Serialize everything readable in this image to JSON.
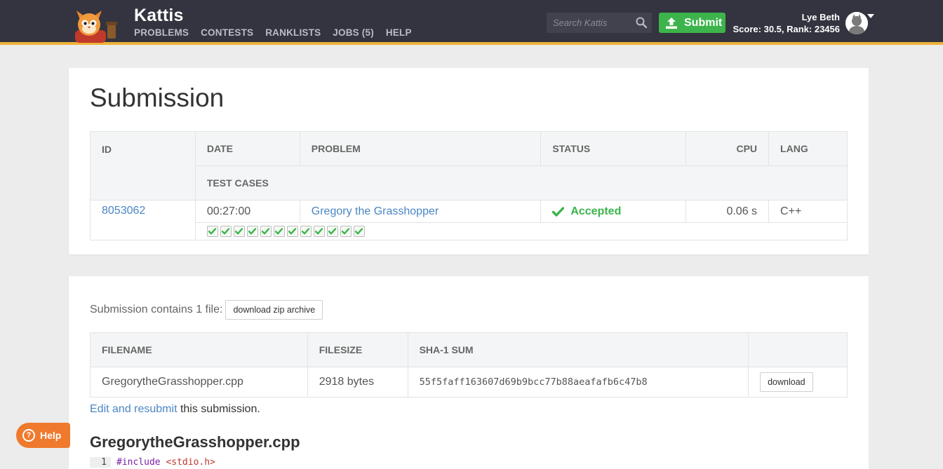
{
  "header": {
    "brand": "Kattis",
    "nav": [
      "PROBLEMS",
      "CONTESTS",
      "RANKLISTS",
      "JOBS (5)",
      "HELP"
    ],
    "search_placeholder": "Search Kattis",
    "submit_label": "Submit",
    "user_name": "Lye Beth",
    "user_score": "Score: 30.5, Rank: 23456",
    "colors": {
      "bar": "#33343f",
      "accent": "#f0b23a",
      "submit": "#3cb44b"
    }
  },
  "submission": {
    "title": "Submission",
    "headers": [
      "ID",
      "DATE",
      "PROBLEM",
      "STATUS",
      "CPU",
      "LANG"
    ],
    "test_cases_header": "TEST CASES",
    "id": "8053062",
    "date": "00:27:00",
    "problem": "Gregory the Grasshopper",
    "status": "Accepted",
    "cpu": "0.06 s",
    "lang": "C++",
    "test_cases_passed": 12,
    "test_cases_total": 12
  },
  "files": {
    "contains_text": "Submission contains 1 file:",
    "zip_button": "download zip archive",
    "headers": [
      "FILENAME",
      "FILESIZE",
      "SHA-1 SUM"
    ],
    "rows": [
      {
        "filename": "GregorytheGrasshopper.cpp",
        "filesize": "2918 bytes",
        "sha1": "55f5faff163607d69b9bcc77b88aeafafb6c47b8",
        "button": "download"
      }
    ],
    "resubmit_link": "Edit and resubmit",
    "resubmit_rest": " this submission."
  },
  "source": {
    "filename": "GregorytheGrasshopper.cpp",
    "line_number": "1",
    "include_kw": "#include",
    "include_header": "<stdio.h>"
  },
  "help_widget": {
    "label": "Help",
    "icon": "?"
  }
}
